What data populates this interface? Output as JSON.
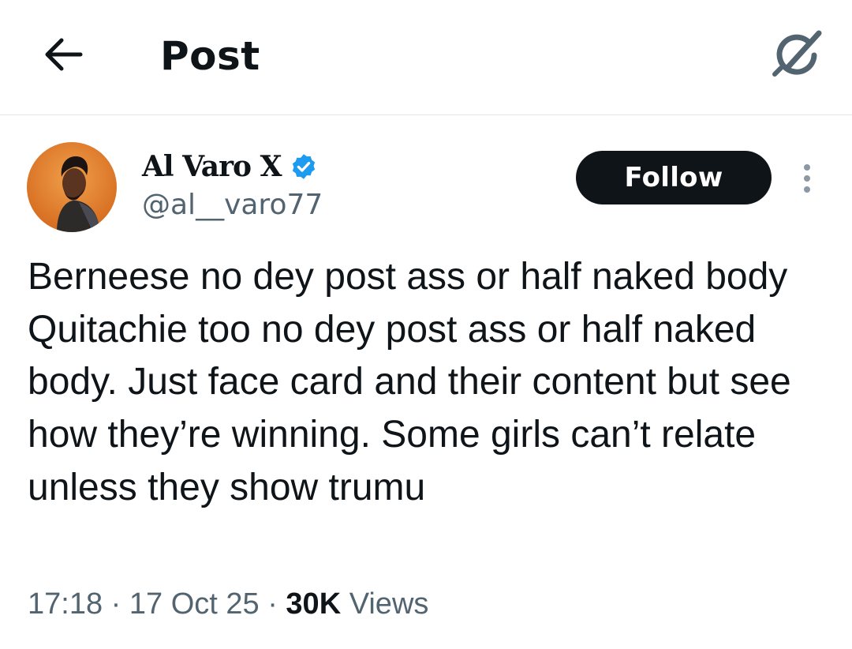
{
  "header": {
    "title": "Post",
    "back_icon": "arrow-left-icon",
    "grok_icon": "grok-icon"
  },
  "author": {
    "display_name": "Al Varo X",
    "handle": "@al__varo77",
    "verified_icon": "verified-badge-icon",
    "verified_color": "#1d9bf0"
  },
  "actions": {
    "follow_label": "Follow",
    "more_icon": "more-vertical-icon"
  },
  "post": {
    "text": "Berneese no dey post ass or half naked body\nQuitachie too no dey post ass or half naked body. Just face card and their content but see how they’re winning. Some girls can’t relate unless they show trumu",
    "time": "17:18",
    "separator": "·",
    "date": "17 Oct 25",
    "views_count": "30K",
    "views_label": "Views"
  },
  "colors": {
    "text_primary": "#0f1419",
    "text_secondary": "#536471",
    "follow_bg": "#0f1419",
    "follow_text": "#ffffff"
  }
}
